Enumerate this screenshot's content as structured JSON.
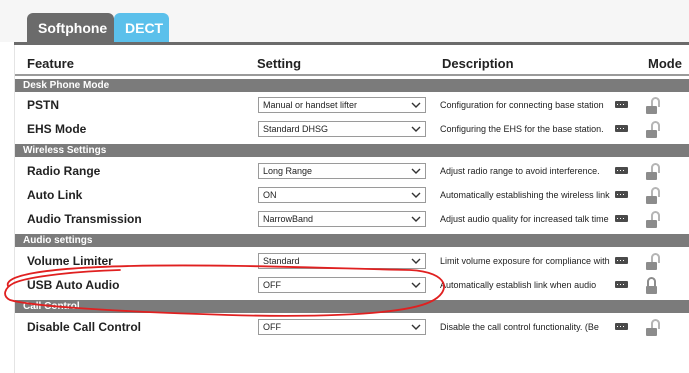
{
  "tabs": [
    {
      "label": "Softphone"
    },
    {
      "label": "DECT"
    }
  ],
  "columns": {
    "feature": "Feature",
    "setting": "Setting",
    "description": "Description",
    "mode": "Mode"
  },
  "sections": [
    {
      "title": "Desk Phone Mode"
    },
    {
      "title": "Wireless Settings"
    },
    {
      "title": "Audio settings"
    },
    {
      "title": "Call Control"
    }
  ],
  "rows": [
    {
      "feature": "PSTN",
      "setting": "Manual or handset lifter",
      "description": "Configuration for connecting base station",
      "locked": false
    },
    {
      "feature": "EHS Mode",
      "setting": "Standard DHSG",
      "description": "Configuring the EHS for the base station.",
      "locked": false
    },
    {
      "feature": "Radio Range",
      "setting": "Long Range",
      "description": "Adjust radio range to avoid interference.",
      "locked": false
    },
    {
      "feature": "Auto Link",
      "setting": "ON",
      "description": "Automatically establishing the wireless link",
      "locked": false
    },
    {
      "feature": "Audio Transmission",
      "setting": "NarrowBand",
      "description": "Adjust audio quality for increased talk time",
      "locked": false
    },
    {
      "feature": "Volume Limiter",
      "setting": "Standard",
      "description": "Limit volume exposure for compliance with",
      "locked": false
    },
    {
      "feature": "USB Auto Audio",
      "setting": "OFF",
      "description": "Automatically establish link when audio",
      "locked": true
    },
    {
      "feature": "Disable Call Control",
      "setting": "OFF",
      "description": "Disable the call control functionality. (Be",
      "locked": false
    }
  ],
  "icons": {
    "dropdown": "chevron-down-icon",
    "more": "more-info-icon",
    "lock_open": "unlocked-icon",
    "lock_closed": "locked-icon"
  },
  "colors": {
    "active_tab": "#6b6b6b",
    "inactive_tab": "#5bc0eb",
    "section_bar": "#7b7b7b",
    "annotation": "#e02020"
  }
}
